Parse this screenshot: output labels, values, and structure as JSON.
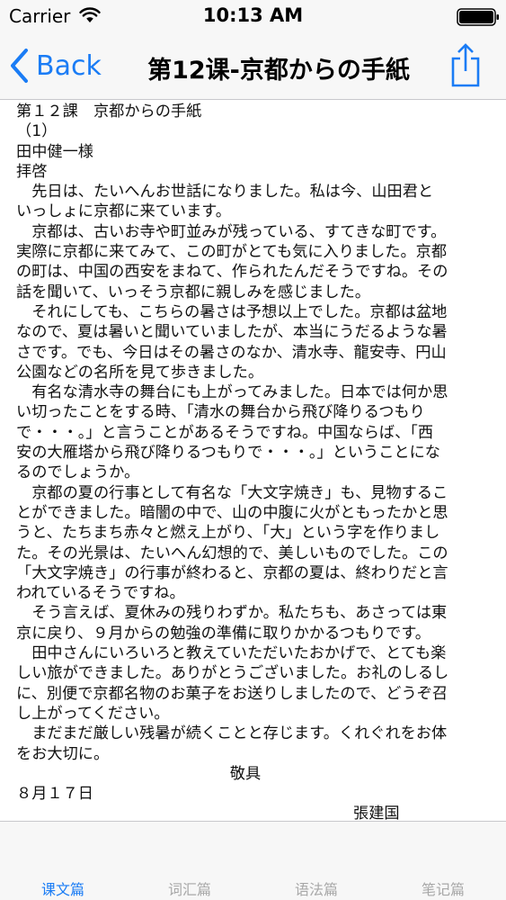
{
  "status_bar": {
    "carrier": "Carrier",
    "time": "10:13 AM"
  },
  "nav": {
    "back_label": "Back",
    "title": "第12课-京都からの手紙"
  },
  "content": {
    "lines": [
      "第１２課　京都からの手紙",
      "（1）",
      "田中健一様",
      "拝啓",
      "　先日は、たいへんお世話になりました。私は今、山田君と",
      "いっしょに京都に来ています。",
      "　京都は、古いお寺や町並みが残っている、すてきな町です。",
      "実際に京都に来てみて、この町がとても気に入りました。京都",
      "の町は、中国の西安をまねて、作られたんだそうですね。その",
      "話を聞いて、いっそう京都に親しみを感じました。",
      "　それにしても、こちらの暑さは予想以上でした。京都は盆地",
      "なので、夏は暑いと聞いていましたが、本当にうだるような暑",
      "さです。でも、今日はその暑さのなか、清水寺、龍安寺、円山",
      "公園などの名所を見て歩きました。",
      "　有名な清水寺の舞台にも上がってみました。日本では何か思",
      "い切ったことをする時、「清水の舞台から飛び降りるつもり",
      "で・・・。」と言うことがあるそうですね。中国ならば、「西",
      "安の大雁塔から飛び降りるつもりで・・・。」ということにな",
      "るのでしょうか。",
      "　京都の夏の行事として有名な「大文字焼き」も、見物するこ",
      "とができました。暗闇の中で、山の中腹に火がともったかと思",
      "うと、たちまち赤々と燃え上がり、「大」という字を作りまし",
      "た。その光景は、たいへん幻想的で、美しいものでした。この",
      "「大文字焼き」の行事が終わると、京都の夏は、終わりだと言",
      "われているそうですね。",
      "　そう言えば、夏休みの残りわずか。私たちも、あさっては東",
      "京に戻り、９月からの勉強の準備に取りかかるつもりです。",
      "　田中さんにいろいろと教えていただいたおかげで、とても楽",
      "しい旅ができました。ありがとうございました。お礼のしるし",
      "に、別便で京都名物のお菓子をお送りしましたので、どうぞ召",
      "し上がってください。",
      "　まだまだ厳しい残暑が続くことと存じます。くれぐれをお体",
      "をお大切に。"
    ],
    "closing": "敬具",
    "date": "８月１７日",
    "sender": "張建国"
  },
  "tabs": [
    {
      "label": "课文篇"
    },
    {
      "label": "词汇篇"
    },
    {
      "label": "语法篇"
    },
    {
      "label": "笔记篇"
    }
  ],
  "colors": {
    "accent": "#1a7cf5",
    "tab_inactive": "#a8a8a8",
    "bar_background": "#f7f7f7"
  },
  "icons": {
    "status": [
      "wifi-icon",
      "battery-icon"
    ],
    "nav": [
      "chevron-left-icon",
      "share-icon"
    ]
  }
}
